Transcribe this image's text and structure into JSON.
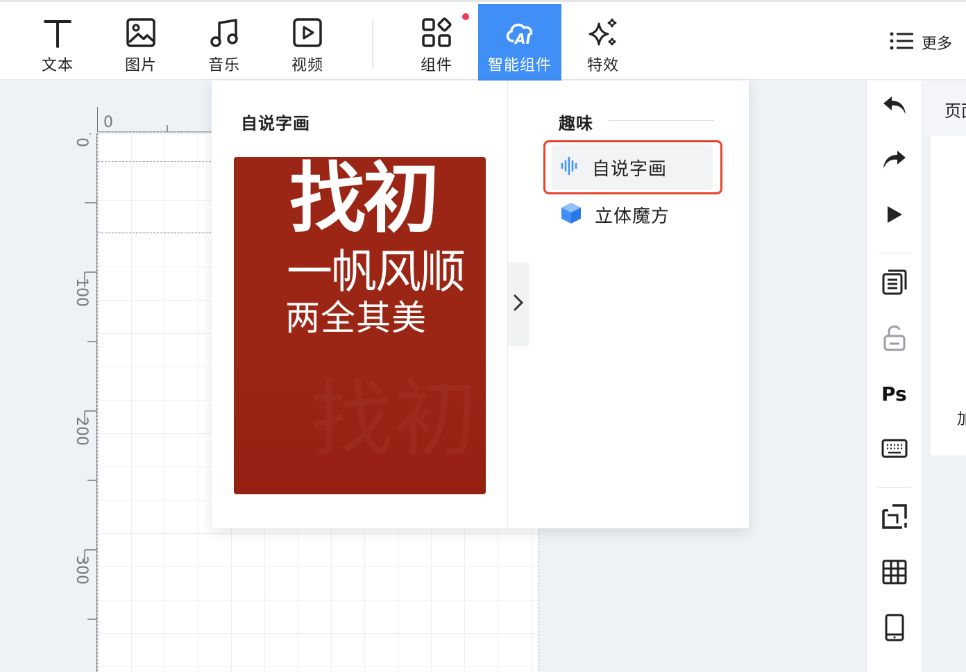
{
  "toolbar": {
    "items": [
      {
        "label": "文本",
        "icon": "text-icon"
      },
      {
        "label": "图片",
        "icon": "image-icon"
      },
      {
        "label": "音乐",
        "icon": "music-icon"
      },
      {
        "label": "视频",
        "icon": "video-icon"
      },
      {
        "label": "组件",
        "icon": "components-icon"
      },
      {
        "label": "智能组件",
        "icon": "ai-cloud-icon",
        "active": true
      },
      {
        "label": "特效",
        "icon": "sparkle-icon"
      }
    ],
    "more_label": "更多",
    "notification_dot_color": "#ee3a5c",
    "active_color": "#3f8ff6"
  },
  "rulers": {
    "top_labels": [
      "0"
    ],
    "left_labels": [
      "0",
      "100",
      "200",
      "300"
    ]
  },
  "dropdown": {
    "preview_title": "自说字画",
    "preview": {
      "line1": "找初",
      "line2": "一帆风顺",
      "line3": "两全其美",
      "background_color": "#9c2616"
    },
    "category_title": "趣味",
    "items": [
      {
        "label": "自说字画",
        "icon": "sound-wave-icon",
        "selected": true
      },
      {
        "label": "立体魔方",
        "icon": "cube-icon",
        "selected": false
      }
    ],
    "highlight_color": "#e8432f"
  },
  "right_tools": [
    "undo-icon",
    "redo-icon",
    "play-icon",
    "pages-icon",
    "unlock-icon",
    "photoshop-icon",
    "keyboard-icon",
    "crop-icon",
    "grid-icon",
    "mobile-icon"
  ],
  "right_panel": {
    "header_text": "页面",
    "body_text": "加"
  }
}
